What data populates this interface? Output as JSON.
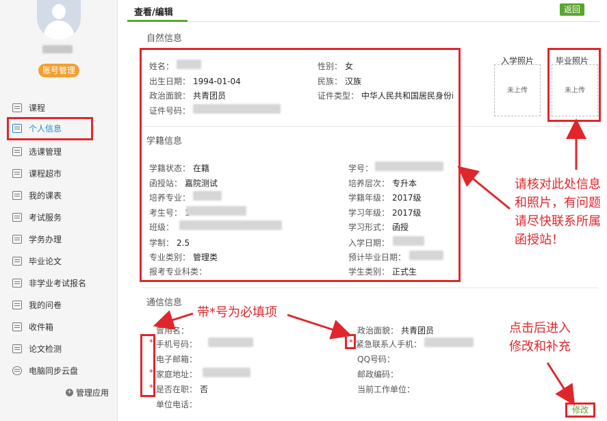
{
  "sidebar": {
    "account_btn": "账号管理",
    "items": [
      {
        "label": "课程",
        "icon": "calendar-icon"
      },
      {
        "label": "个人信息",
        "icon": "id-card-icon"
      },
      {
        "label": "选课管理",
        "icon": "calendar-icon"
      },
      {
        "label": "课程超市",
        "icon": "calendar-icon"
      },
      {
        "label": "我的课表",
        "icon": "id-card-icon"
      },
      {
        "label": "考试服务",
        "icon": "id-card-icon"
      },
      {
        "label": "学务办理",
        "icon": "id-card-icon"
      },
      {
        "label": "毕业论文",
        "icon": "id-card-icon"
      },
      {
        "label": "非学业考试报名",
        "icon": "id-card-icon"
      },
      {
        "label": "我的问卷",
        "icon": "calendar-icon"
      },
      {
        "label": "收件箱",
        "icon": "inbox-icon"
      },
      {
        "label": "论文检测",
        "icon": "document-icon"
      },
      {
        "label": "电脑同步云盘",
        "icon": "cloud-icon"
      }
    ],
    "manage_apps": "管理应用"
  },
  "header": {
    "tab": "查看/编辑",
    "back": "返回"
  },
  "natural": {
    "title": "自然信息",
    "name_label": "姓名：",
    "dob_label": "出生日期：",
    "dob": "1994-01-04",
    "political_label": "政治面貌：",
    "political": "共青团员",
    "idno_label": "证件号码：",
    "gender_label": "性别：",
    "gender": "女",
    "ethnic_label": "民族：",
    "ethnic": "汉族",
    "idtype_label": "证件类型：",
    "idtype": "中华人民共和国居民身份i"
  },
  "photos": {
    "enroll": "入学照片",
    "grad": "毕业照片",
    "none": "未上传"
  },
  "school": {
    "title": "学籍信息",
    "status_label": "学籍状态：",
    "status": "在籍",
    "station_label": "函授站：",
    "station": "嘉院测试",
    "major_label": "培养专业：",
    "examno_label": "考生号：",
    "examno_prefix": "1",
    "class_label": "班级：",
    "class_prefix": "",
    "duration_label": "学制：",
    "duration": "2.5",
    "category_label": "专业类别：",
    "category": "管理类",
    "apply_major_label": "报考专业科类：",
    "stuno_label": "学号：",
    "level_label": "培养层次：",
    "level": "专升本",
    "grade_label": "学籍年级：",
    "grade": "2017级",
    "study_year_label": "学习年级：",
    "study_year": "2017级",
    "mode_label": "学习形式：",
    "mode": "函授",
    "enroll_date_label": "入学日期：",
    "grad_date_label": "预计毕业日期：",
    "stu_type_label": "学生类别：",
    "stu_type": "正式生"
  },
  "contact": {
    "title": "通信信息",
    "former_name_label": "曾用名：",
    "mobile_label": "手机号码：",
    "email_label": "电子邮箱：",
    "address_label": "家庭地址：",
    "employed_label": "是否在职：",
    "employed": "否",
    "work_phone_label": "单位电话：",
    "political_label": "政治面貌：",
    "political": "共青团员",
    "emergency_label": "紧急联系人手机：",
    "qq_label": "QQ号码：",
    "postcode_label": "邮政编码：",
    "employer_label": "当前工作单位：",
    "required_mark": "*",
    "modify": "修改"
  },
  "annotations": {
    "verify": "请核对此处信息和照片，有问题请尽快联系所属函授站！",
    "required": "带*号为必填项",
    "click": "点击后进入修改和补充"
  },
  "colors": {
    "accent_green": "#5aa52e",
    "annot_red": "#e0262b",
    "badge_orange": "#f2a033"
  }
}
